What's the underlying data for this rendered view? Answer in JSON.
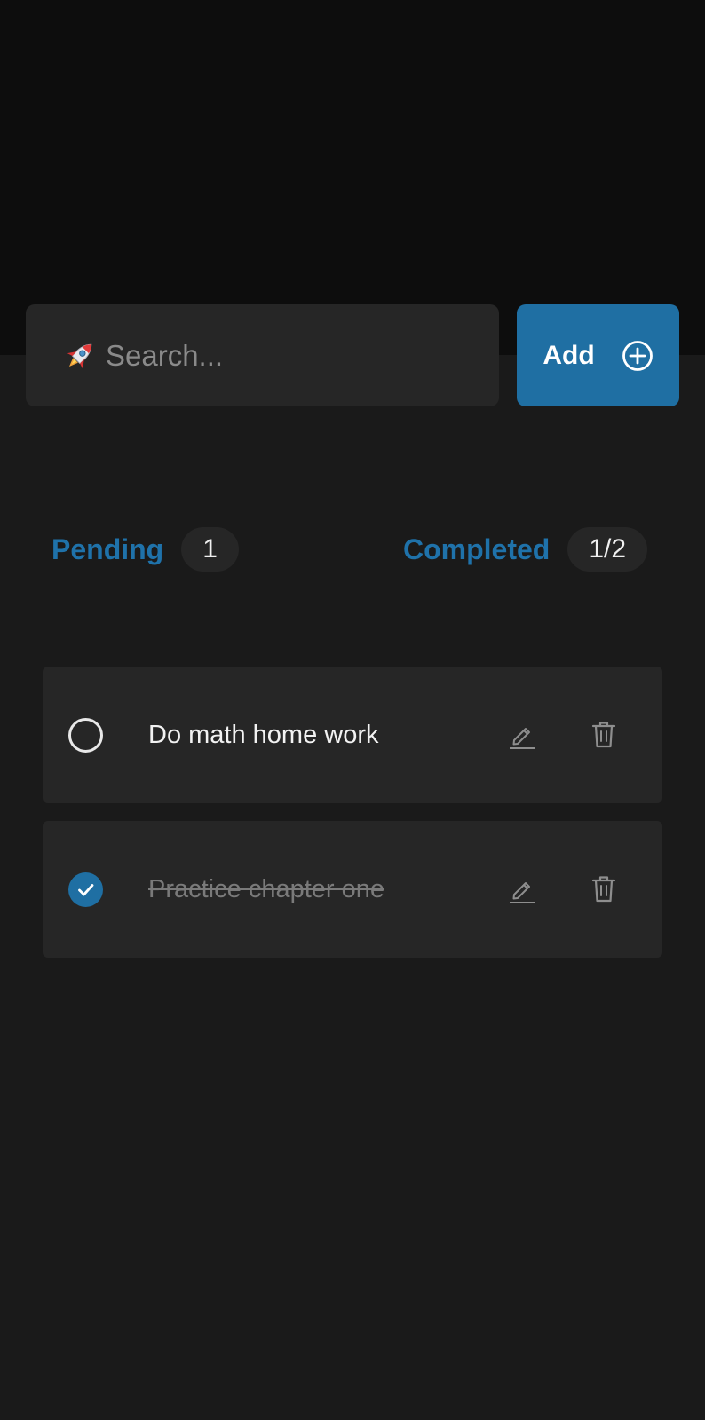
{
  "search": {
    "placeholder": "Search...",
    "value": "",
    "icon": "rocket-icon"
  },
  "add_button": {
    "label": "Add",
    "icon": "plus-circle-icon"
  },
  "counters": {
    "pending": {
      "label": "Pending",
      "count": "1"
    },
    "completed": {
      "label": "Completed",
      "count": "1/2"
    }
  },
  "tasks": [
    {
      "text": "Do math home work",
      "completed": false
    },
    {
      "text": "Practice chapter one",
      "completed": true
    }
  ],
  "colors": {
    "accent": "#1f6fa3",
    "background": "#1a1a1a",
    "header": "#0d0d0d",
    "card": "#262626"
  }
}
